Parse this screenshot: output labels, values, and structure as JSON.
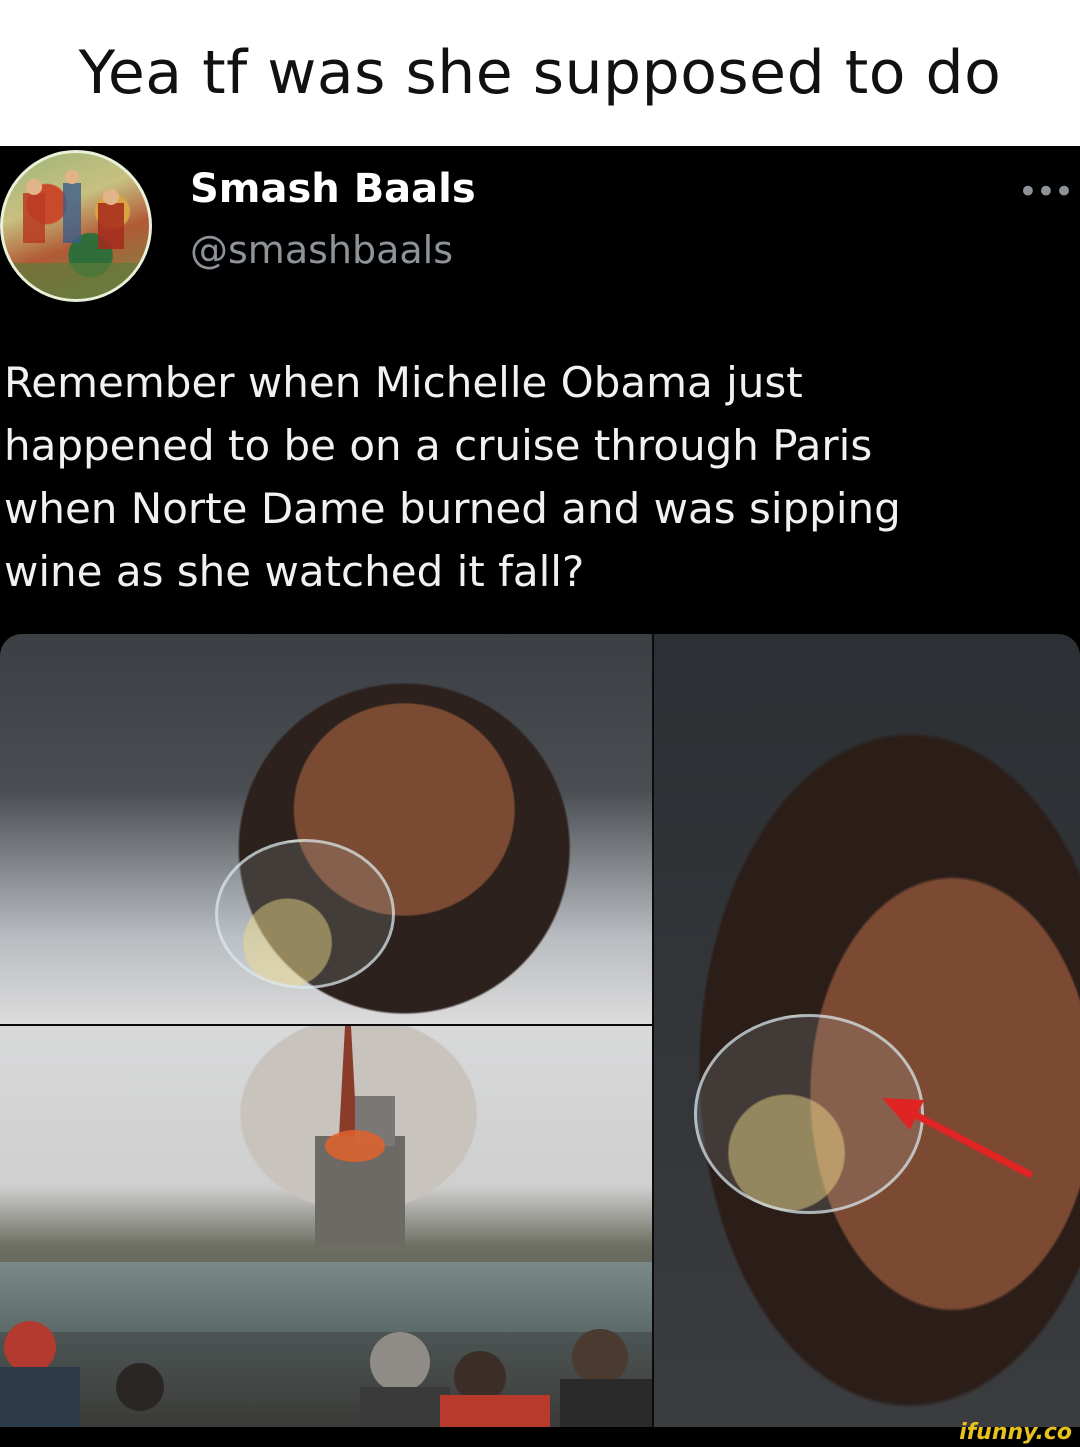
{
  "caption": "Yea tf was she supposed to do",
  "tweet": {
    "display_name": "Smash Baals",
    "handle": "@smashbaals",
    "more_icon": "more-options-icon",
    "text_lines": [
      "Remember when Michelle Obama just",
      "happened to be on a cruise through Paris",
      "when Norte Dame burned and was sipping",
      "wine as she watched it fall?"
    ]
  },
  "watermark": "ifunny.co",
  "colors": {
    "tweet_background": "#000000",
    "handle_gray": "#8e9399",
    "watermark_yellow": "#e8c21c",
    "arrow_red": "#e02424"
  }
}
